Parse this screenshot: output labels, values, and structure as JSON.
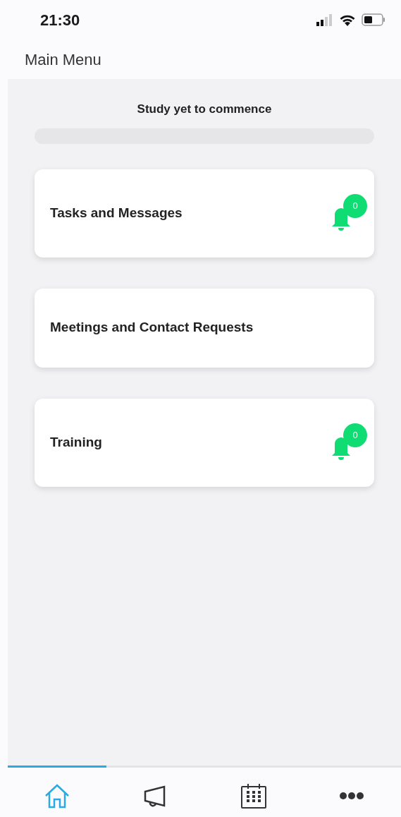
{
  "status_bar": {
    "time": "21:30"
  },
  "header": {
    "title": "Main Menu"
  },
  "study": {
    "label": "Study yet to commence",
    "progress": {
      "level": 0
    }
  },
  "cards": [
    {
      "title": "Tasks and Messages",
      "badge": "0"
    },
    {
      "title": "Meetings and Contact Requests"
    },
    {
      "title": "Training",
      "badge": "0"
    }
  ],
  "tabs": [
    {
      "kind": "home",
      "selected": true
    },
    {
      "kind": "announcements",
      "selected": false
    },
    {
      "kind": "calendar",
      "selected": false
    },
    {
      "kind": "more",
      "selected": false
    }
  ]
}
